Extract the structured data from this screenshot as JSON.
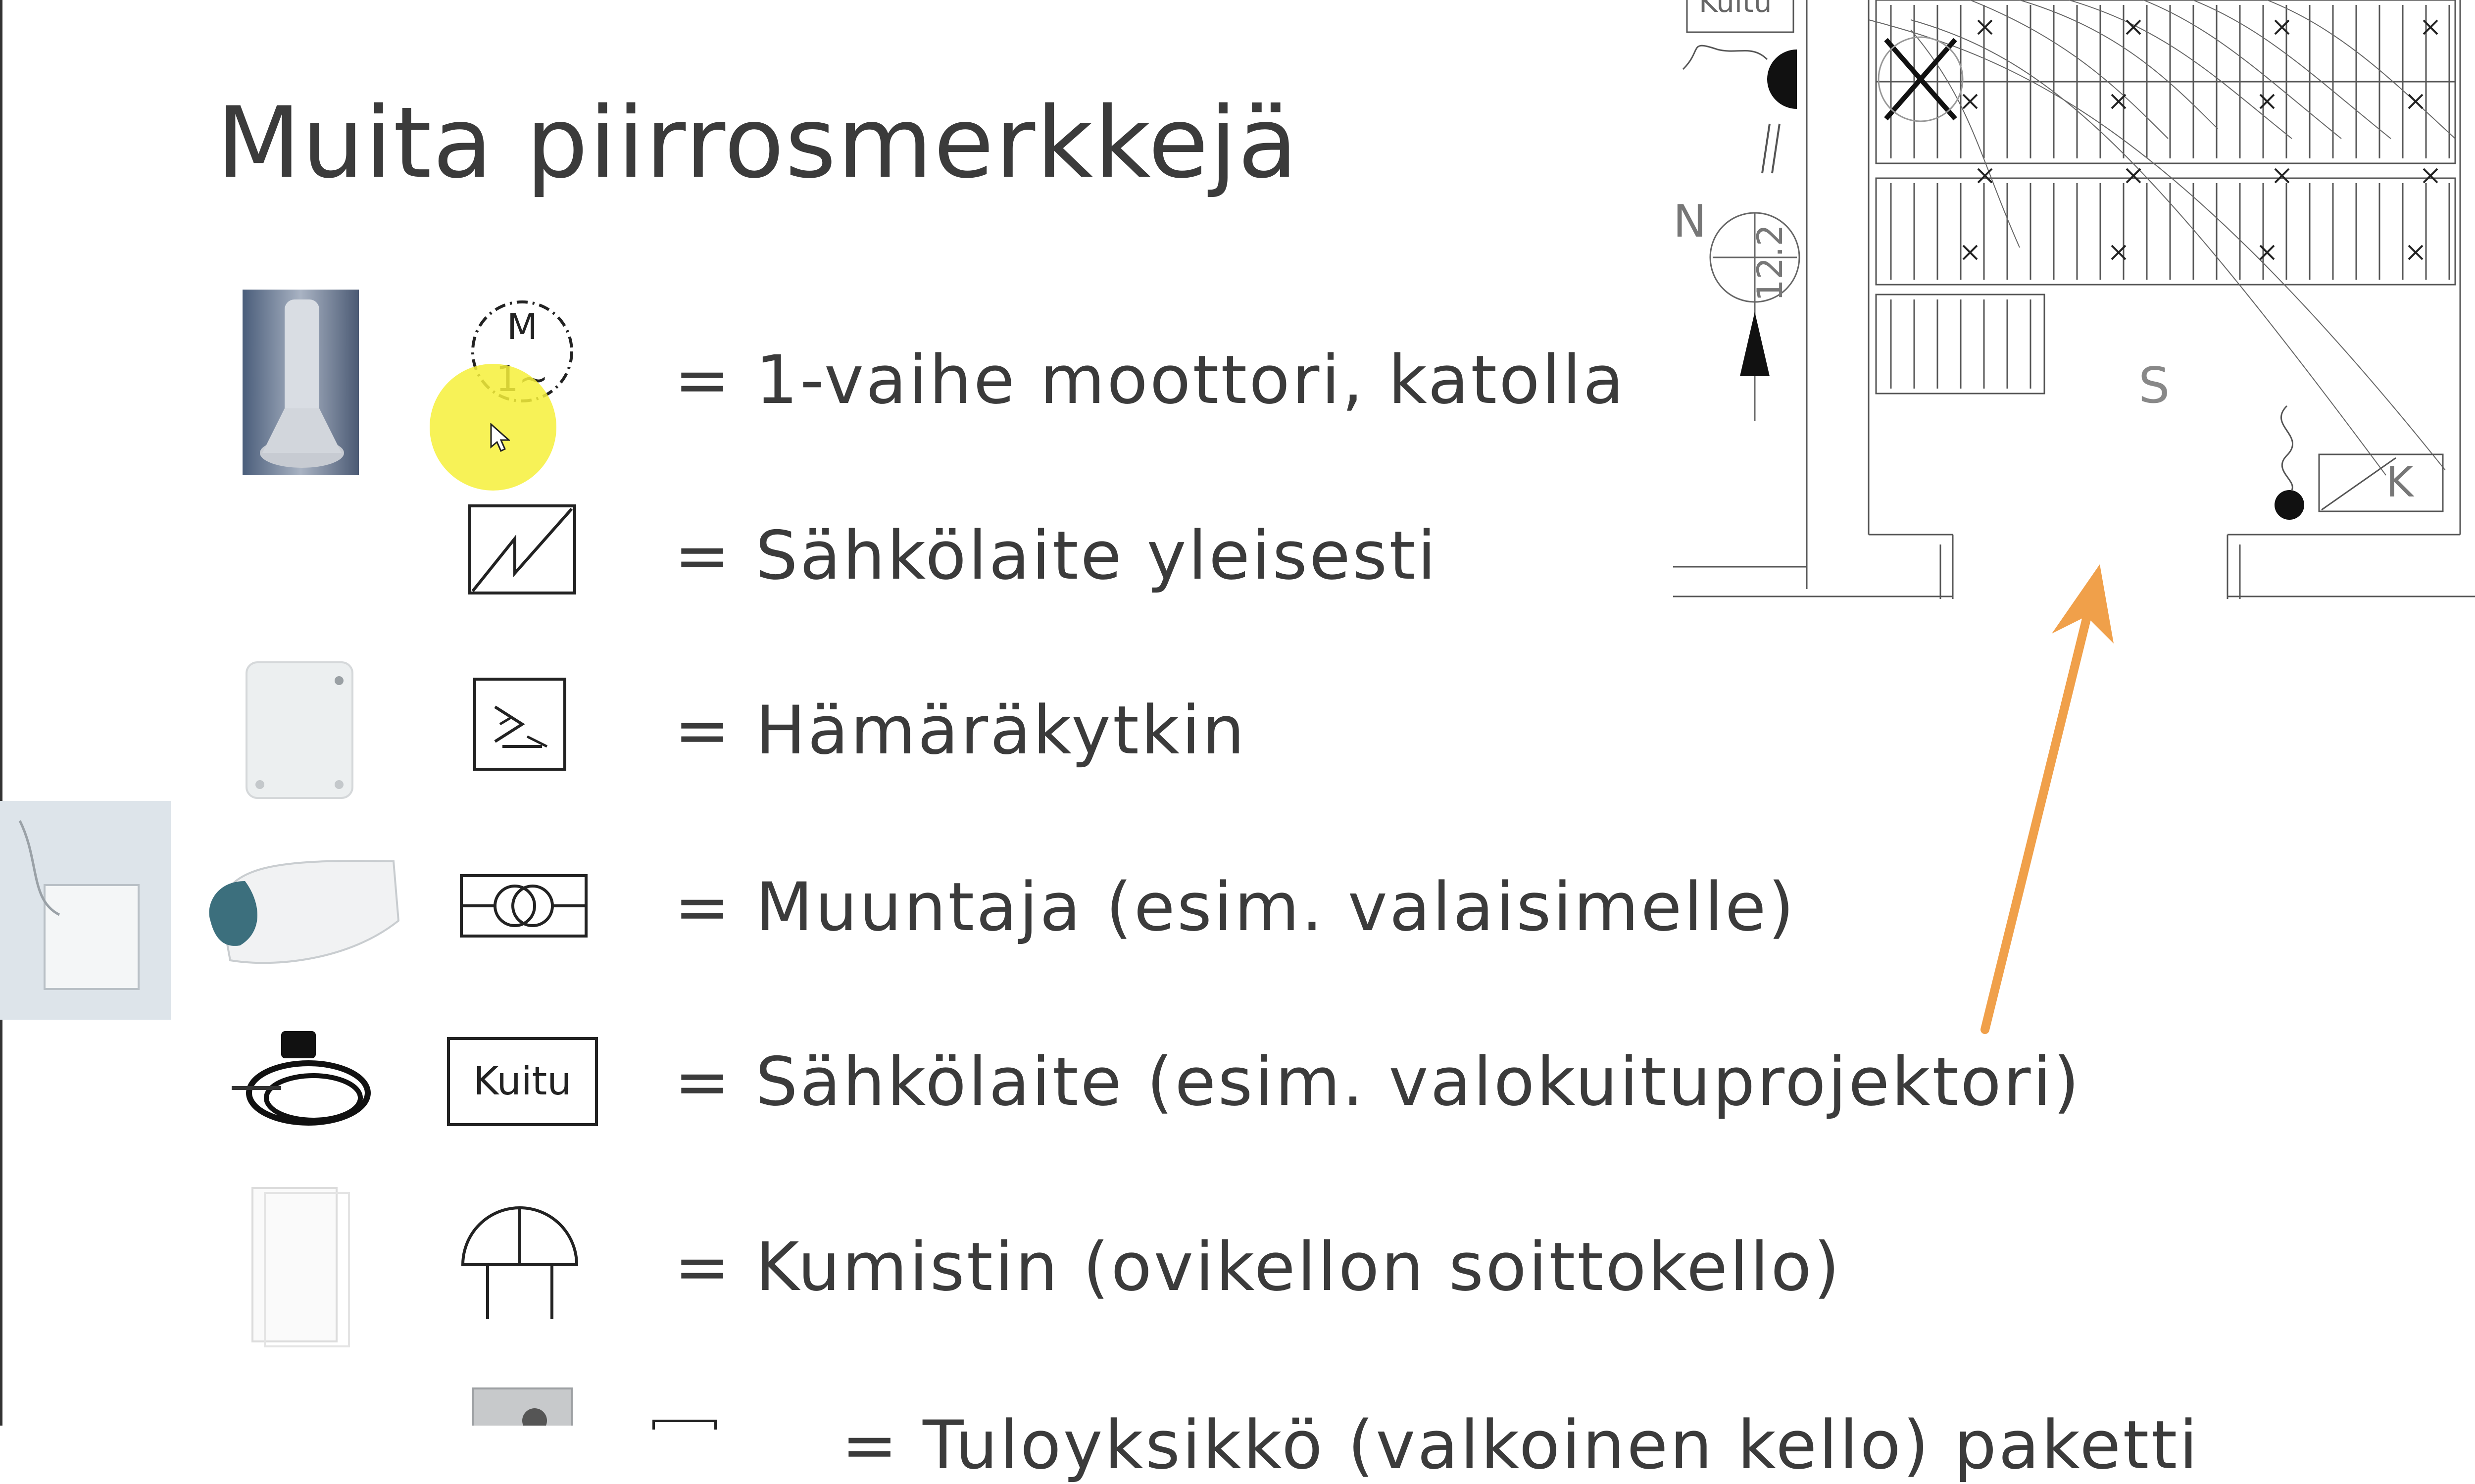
{
  "slide": {
    "title": "Muita piirrosmerkkejä",
    "rows": [
      {
        "text": "= 1-vaihe moottori, katolla",
        "symbol_text": "M",
        "symbol_subtext": "1~"
      },
      {
        "text": "= Sähkölaite yleisesti"
      },
      {
        "text": "= Hämäräkytkin"
      },
      {
        "text": "= Muuntaja (esim. valaisimelle)"
      },
      {
        "text": "= Sähkölaite (esim. valokuituprojektori)",
        "symbol_text": "Kuitu"
      },
      {
        "text": "= Kumistin (ovikellon soittokello)"
      },
      {
        "text": "= Tuloyksikkö (valkoinen kello) paketti"
      }
    ]
  },
  "floorplan": {
    "label_kuitu": "Kuitu",
    "label_n": "N",
    "label_num": "12.2",
    "label_s": "S",
    "label_k": "K"
  },
  "colors": {
    "arrow": "#f0a04a",
    "highlight": "#f6f03a",
    "text": "#3b3b3b"
  }
}
